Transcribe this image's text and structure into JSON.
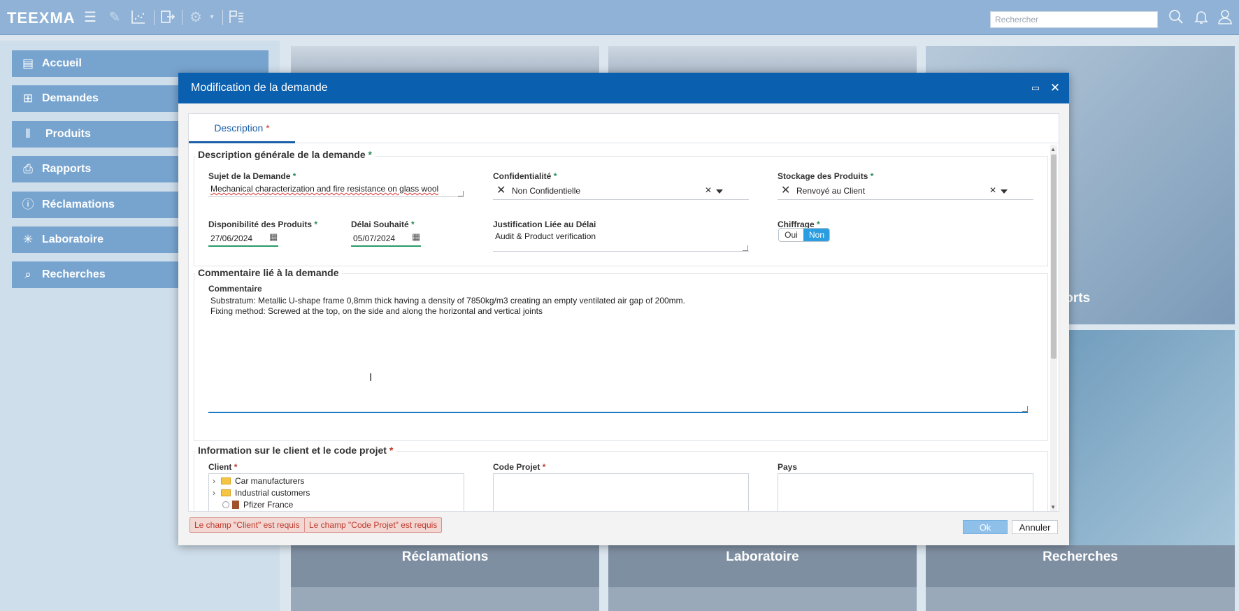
{
  "app": {
    "logo": "TEEXMA",
    "search_placeholder": "Rechercher"
  },
  "sidebar": {
    "items": [
      {
        "label": "Accueil",
        "icon": "home-icon"
      },
      {
        "label": "Demandes",
        "icon": "box-icon"
      },
      {
        "label": "Produits",
        "icon": "flask-icon"
      },
      {
        "label": "Rapports",
        "icon": "report-icon"
      },
      {
        "label": "Réclamations",
        "icon": "alert-icon"
      },
      {
        "label": "Laboratoire",
        "icon": "asterisk-icon"
      },
      {
        "label": "Recherches",
        "icon": "search-icon"
      }
    ]
  },
  "tiles": {
    "reclamations": "Réclamations",
    "laboratoire": "Laboratoire",
    "recherches": "Recherches",
    "rapports_partial": "pports"
  },
  "modal": {
    "title": "Modification de la demande",
    "tab_label": "Description",
    "section1": {
      "title": "Description générale de la demande",
      "sujet_label": "Sujet de la Demande",
      "sujet_value": "Mechanical characterization and fire resistance on glass wool",
      "confidentialite_label": "Confidentialité",
      "confidentialite_value": "Non Confidentielle",
      "stockage_label": "Stockage des Produits",
      "stockage_value": "Renvoyé au Client",
      "disponibilite_label": "Disponibilité des Produits",
      "disponibilite_value": "27/06/2024",
      "delai_label": "Délai Souhaité",
      "delai_value": "05/07/2024",
      "justification_label": "Justification Liée au Délai",
      "justification_value": "Audit & Product verification",
      "chiffrage_label": "Chiffrage",
      "chiffrage_oui": "Oui",
      "chiffrage_non": "Non"
    },
    "section2": {
      "title": "Commentaire lié à la demande",
      "commentaire_label": "Commentaire",
      "line1": "Substratum: Metallic U-shape frame 0,8mm thick having a density of 7850kg/m3 creating an empty ventilated air gap of 200mm.",
      "line2": "Fixing method: Screwed at the top, on the side and along the horizontal and vertical joints"
    },
    "section3": {
      "title": "Information sur le client et le code projet",
      "client_label": "Client",
      "client_tree": [
        "Car manufacturers",
        "Industrial customers",
        "Pfizer France"
      ],
      "code_label": "Code Projet",
      "pays_label": "Pays"
    },
    "errors": [
      "Le champ \"Client\" est requis",
      "Le champ \"Code Projet\" est requis"
    ],
    "ok_label": "Ok",
    "cancel_label": "Annuler"
  }
}
